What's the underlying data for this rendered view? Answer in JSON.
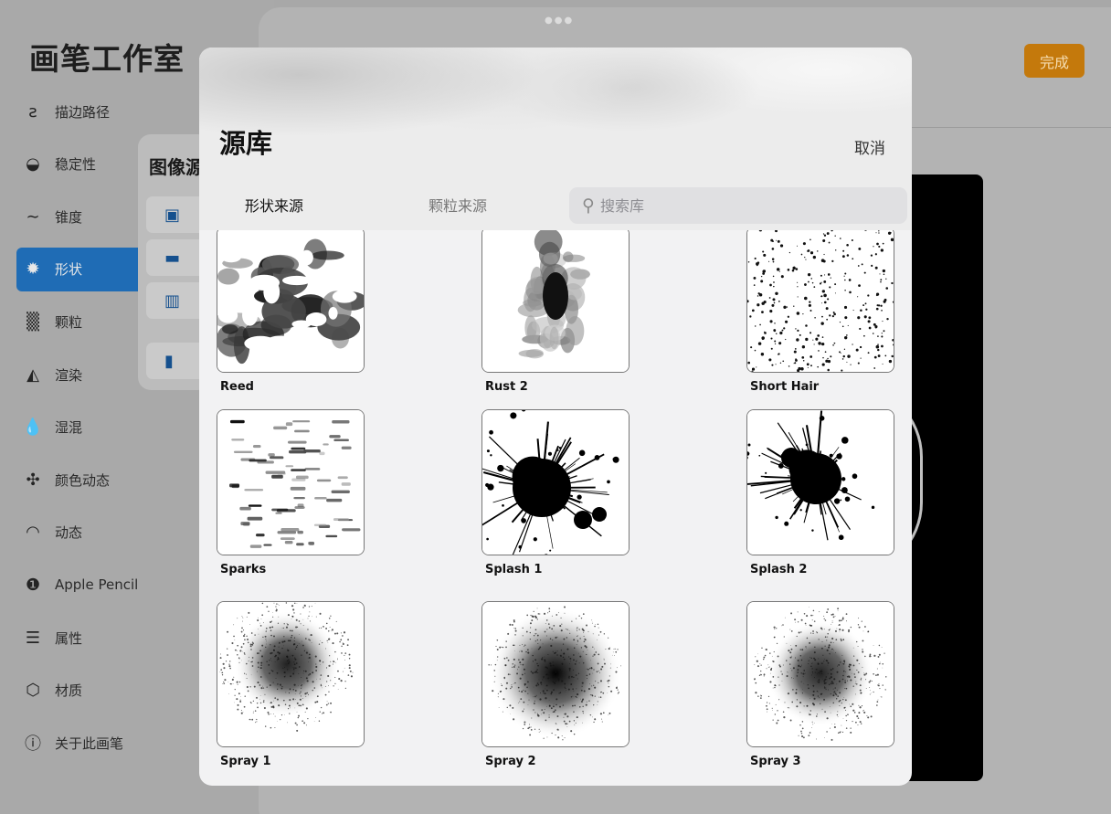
{
  "sidebar": {
    "title": "画笔工作室",
    "items": [
      {
        "label": "描边路径",
        "icon": "stroke-path-icon",
        "glyph": "ƨ"
      },
      {
        "label": "稳定性",
        "icon": "stabilization-icon",
        "glyph": "◒"
      },
      {
        "label": "锥度",
        "icon": "taper-icon",
        "glyph": "∼"
      },
      {
        "label": "形状",
        "icon": "shape-icon",
        "glyph": "✹"
      },
      {
        "label": "颗粒",
        "icon": "grain-icon",
        "glyph": "▒"
      },
      {
        "label": "渲染",
        "icon": "rendering-icon",
        "glyph": "◭"
      },
      {
        "label": "湿混",
        "icon": "wet-mix-icon",
        "glyph": "💧"
      },
      {
        "label": "颜色动态",
        "icon": "color-dynamics-icon",
        "glyph": "✣"
      },
      {
        "label": "动态",
        "icon": "dynamics-icon",
        "glyph": "◠"
      },
      {
        "label": "Apple Pencil",
        "icon": "apple-pencil-icon",
        "glyph": "❶"
      },
      {
        "label": "属性",
        "icon": "properties-icon",
        "glyph": "☰"
      },
      {
        "label": "材质",
        "icon": "materials-icon",
        "glyph": "⬡"
      },
      {
        "label": "关于此画笔",
        "icon": "info-icon",
        "glyph": "ⓘ"
      }
    ],
    "active_index": 3
  },
  "editor": {
    "done_label": "完成"
  },
  "popover": {
    "title": "图像源"
  },
  "modal": {
    "title": "源库",
    "cancel_label": "取消",
    "tabs": [
      {
        "label": "形状来源",
        "active": true
      },
      {
        "label": "颗粒来源",
        "active": false
      }
    ],
    "search_placeholder": "搜索库",
    "items": [
      {
        "name": "Reed",
        "kind": "reed"
      },
      {
        "name": "Rust 2",
        "kind": "rust"
      },
      {
        "name": "Short Hair",
        "kind": "hair"
      },
      {
        "name": "Sparks",
        "kind": "sparks"
      },
      {
        "name": "Splash 1",
        "kind": "splash1"
      },
      {
        "name": "Splash 2",
        "kind": "splash2"
      },
      {
        "name": "Spray 1",
        "kind": "spray1"
      },
      {
        "name": "Spray 2",
        "kind": "spray2"
      },
      {
        "name": "Spray 3",
        "kind": "spray3"
      }
    ]
  },
  "colors": {
    "accent_blue": "#1f6cb5",
    "done_orange": "#c4790c"
  }
}
